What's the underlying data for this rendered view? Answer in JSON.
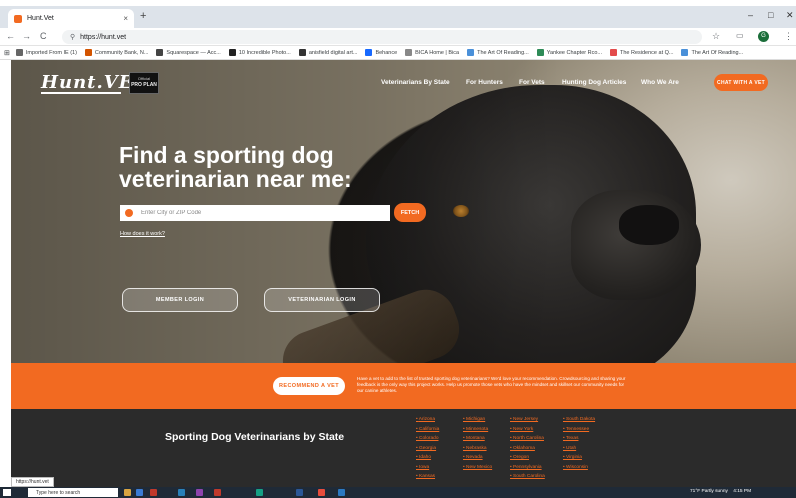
{
  "browser": {
    "tab_title": "Hunt.Vet",
    "tab_close": "×",
    "new_tab": "+",
    "url": "https://hunt.vet",
    "back": "←",
    "forward": "→",
    "reload": "C",
    "site_info": "⚲",
    "star": "☆",
    "menu": "⋮",
    "profile_initial": "G",
    "win_min": "–",
    "win_max": "□",
    "win_close": "✕",
    "bookmarks": [
      {
        "label": "Imported From IE (1)",
        "color": "#666666"
      },
      {
        "label": "Community Bank, N...",
        "color": "#d35400"
      },
      {
        "label": "Squarespace — Acc...",
        "color": "#444444"
      },
      {
        "label": "10 Incredible Photo...",
        "color": "#222222",
        "icon": "M"
      },
      {
        "label": "anisfield digital art...",
        "color": "#333333"
      },
      {
        "label": "Behance",
        "color": "#1769ff"
      },
      {
        "label": "BICA Home | Bica",
        "color": "#888888"
      },
      {
        "label": "The Art Of Reading...",
        "color": "#4a90d9"
      },
      {
        "label": "Yankee Chapter Rco...",
        "color": "#2e8b57"
      },
      {
        "label": "The Residence at Q...",
        "color": "#e34b4b"
      },
      {
        "label": "The Art Of Reading...",
        "color": "#4a90d9"
      }
    ]
  },
  "site": {
    "logo": "Hunt.VET",
    "sponsor_top": "Official",
    "sponsor_brand": "PRO PLAN",
    "nav": [
      "Veterinarians By State",
      "For Hunters",
      "For Vets",
      "Hunting Dog Articles",
      "Who We Are"
    ],
    "chat_button": "CHAT WITH A VET",
    "headline": "Find a sporting dog veterinarian near me:",
    "search_placeholder": "Enter City or ZIP Code",
    "fetch_button": "FETCH",
    "how_link": "How does it work?",
    "member_login": "MEMBER LOGIN",
    "vet_login": "VETERINARIAN LOGIN",
    "recommend_button": "RECOMMEND A VET",
    "recommend_text": "Have a vet to add to the list of trusted sporting dog veterinarians? We'd love your recommendation. Crowdsourcing and sharing your feedback is the only way this project works. Help us promote those vets who have the mindset and skillset our community needs for our canine athletes.",
    "states_heading": "Sporting Dog Veterinarians by State",
    "state_columns": [
      [
        "Arizona",
        "California",
        "Colorado",
        "Georgia",
        "Idaho",
        "Iowa",
        "Kansas"
      ],
      [
        "Michigan",
        "Minnesota",
        "Montana",
        "Nebraska",
        "Nevada",
        "New Mexico"
      ],
      [
        "New Jersey",
        "New York",
        "North Carolina",
        "Oklahoma",
        "Oregon",
        "Pennsylvania",
        "South Carolina"
      ],
      [
        "South Dakota",
        "Tennessee",
        "Texas",
        "Utah",
        "Virginia",
        "Wisconsin"
      ]
    ]
  },
  "status_url": "https://hunt.vet",
  "taskbar": {
    "search_placeholder": "Type here to search",
    "weather": "71°F  Partly sunny",
    "time": "4:15 PM"
  }
}
